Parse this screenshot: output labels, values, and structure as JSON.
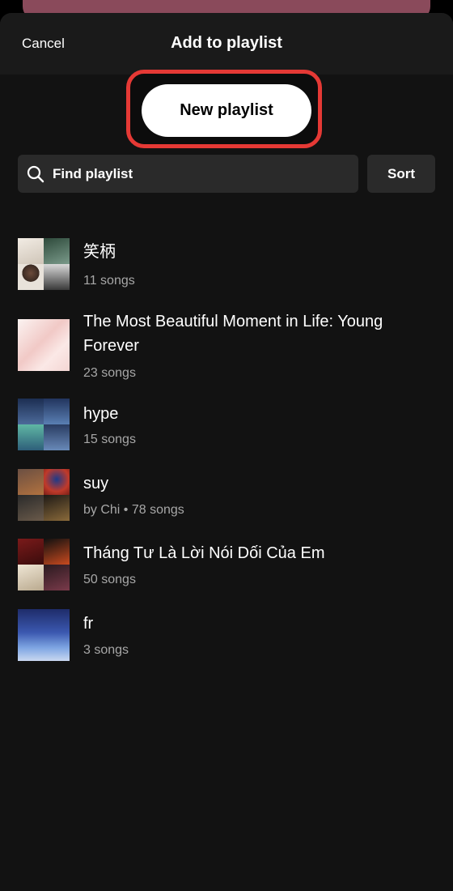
{
  "header": {
    "cancel_label": "Cancel",
    "title": "Add to playlist"
  },
  "actions": {
    "new_playlist_label": "New playlist",
    "search_placeholder": "Find playlist",
    "sort_label": "Sort"
  },
  "colors": {
    "highlight_border": "#e53935",
    "sheet_background": "#121212",
    "field_background": "#2a2a2a",
    "secondary_text": "#a7a7a7"
  },
  "playlists": [
    {
      "title": "笑柄",
      "subtitle": "11 songs"
    },
    {
      "title": "The Most Beautiful Moment in Life: Young Forever",
      "subtitle": "23 songs"
    },
    {
      "title": "hype",
      "subtitle": "15 songs"
    },
    {
      "title": "suy",
      "subtitle": "by Chi • 78 songs"
    },
    {
      "title": "Tháng Tư Là Lời Nói Dối Của Em",
      "subtitle": "50 songs"
    },
    {
      "title": "fr",
      "subtitle": "3 songs"
    }
  ]
}
